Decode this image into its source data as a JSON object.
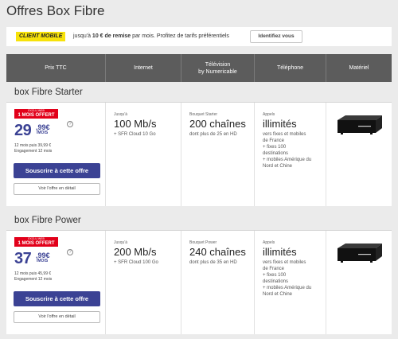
{
  "page": {
    "title": "Offres Box Fibre"
  },
  "promo": {
    "tag": "CLIENT MOBILE",
    "text_prefix": "jusqu'à",
    "text_bold": "10 € de remise",
    "text_suffix": "par mois. Profitez de tarifs préférentiels",
    "button": "Identifiez vous"
  },
  "table_header": {
    "price": "Prix TTC",
    "internet": "Internet",
    "tv_line1": "Télévision",
    "tv_line2": "by Numericable",
    "phone": "Téléphone",
    "equipment": "Matériel"
  },
  "offers": [
    {
      "name": "box Fibre Starter",
      "badge_small": "EXCLU WEB",
      "badge_main": "1 MOIS OFFERT",
      "price_int": "29",
      "price_dec": ",99€",
      "price_unit": "/MOIS",
      "note_price": "12 mois puis 39,99 €",
      "note_engagement": "Engagement 12 mois",
      "subscribe": "Souscrire à cette offre",
      "detail": "Voir l'offre en détail",
      "internet_pre": "Jusqu'à",
      "internet_speed": "100 Mb/s",
      "internet_extra": "+ SFR Cloud 10 Go",
      "tv_pre": "Bouquet Starter",
      "tv_channels": "200 chaînes",
      "tv_hd": "dont plus de 25 en HD",
      "phone_pre": "Appels",
      "phone_main": "illimités",
      "phone_lines": [
        "vers fixes et mobiles",
        "de France",
        "+ fixes 100",
        "destinations",
        "+ mobiles Amérique du",
        "Nord et Chine"
      ]
    },
    {
      "name": "box Fibre Power",
      "badge_small": "EXCLU WEB",
      "badge_main": "1 MOIS OFFERT",
      "price_int": "37",
      "price_dec": ",99€",
      "price_unit": "/MOIS",
      "note_price": "12 mois puis 45,99 €",
      "note_engagement": "Engagement 12 mois",
      "subscribe": "Souscrire à cette offre",
      "detail": "Voir l'offre en détail",
      "internet_pre": "Jusqu'à",
      "internet_speed": "200 Mb/s",
      "internet_extra": "+ SFR Cloud 100 Go",
      "tv_pre": "Bouquet Power",
      "tv_channels": "240 chaînes",
      "tv_hd": "dont plus de 35 en HD",
      "phone_pre": "Appels",
      "phone_main": "illimités",
      "phone_lines": [
        "vers fixes et mobiles",
        "de France",
        "+ fixes 100",
        "destinations",
        "+ mobiles Amérique du",
        "Nord et Chine"
      ]
    }
  ],
  "colors": {
    "accent": "#3b4294",
    "badge": "#e2001a",
    "promo_tag": "#f7e20a",
    "header_bg": "#5c5c5c"
  }
}
